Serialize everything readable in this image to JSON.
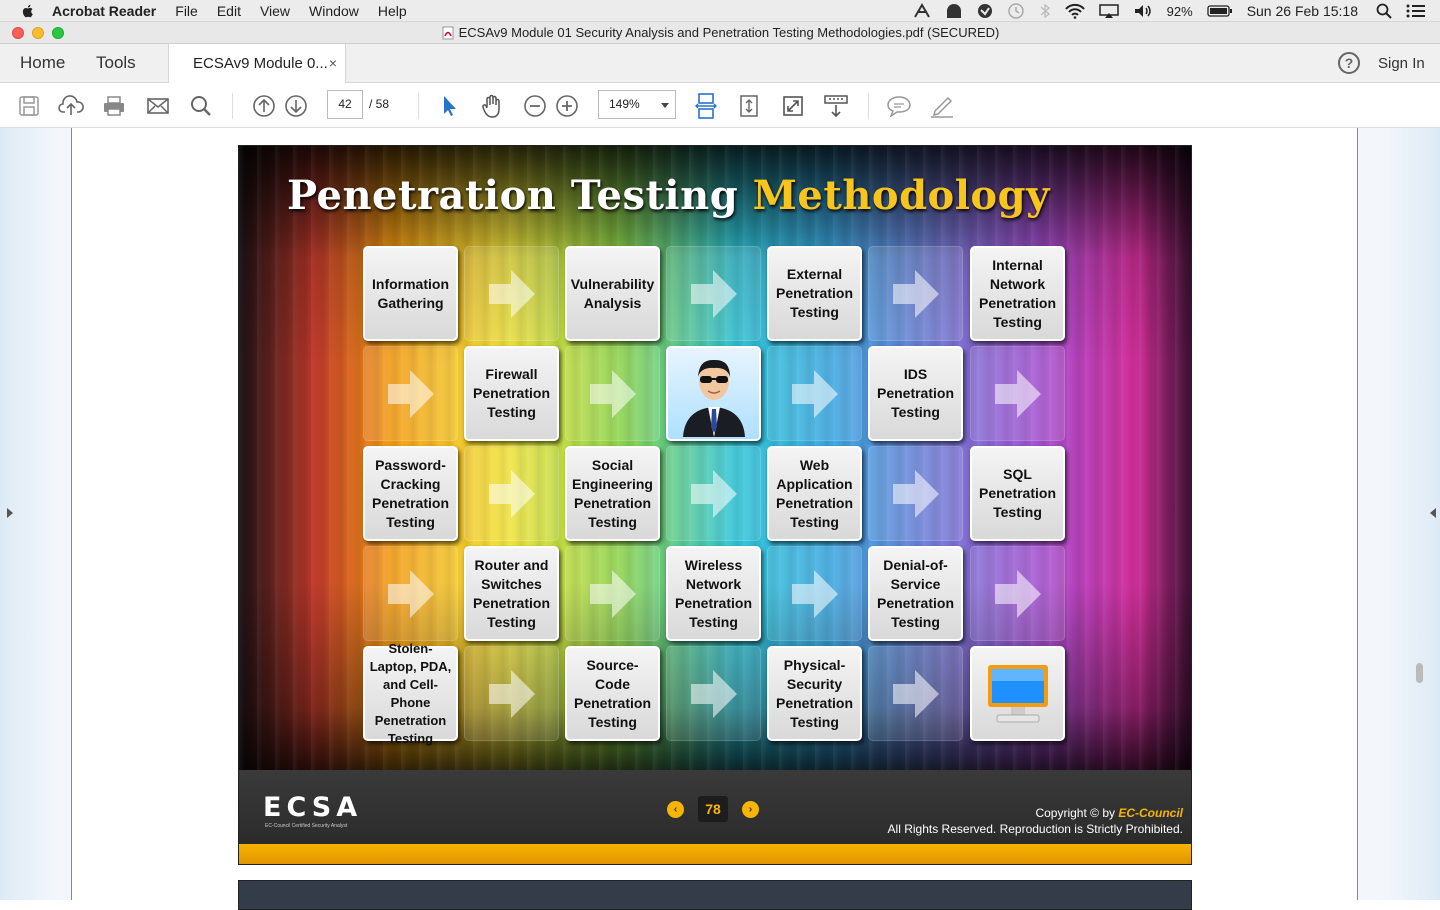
{
  "menubar": {
    "app_name": "Acrobat Reader",
    "items": [
      "File",
      "Edit",
      "View",
      "Window",
      "Help"
    ],
    "battery": "92%",
    "datetime": "Sun 26 Feb  15:18"
  },
  "window": {
    "title": "ECSAv9 Module 01 Security Analysis and Penetration Testing Methodologies.pdf (SECURED)"
  },
  "tabs": {
    "home": "Home",
    "tools": "Tools",
    "document": "ECSAv9 Module 0...",
    "close": "×",
    "help": "?",
    "sign_in": "Sign In"
  },
  "toolbar": {
    "current_page": "42",
    "page_total": "/  58",
    "zoom": "149%"
  },
  "slide": {
    "title_main": "Penetration Testing ",
    "title_highlight": "Methodology",
    "boxes": [
      "Information Gathering",
      "Vulnerability Analysis",
      "External Penetration Testing",
      "Internal Network Penetration Testing",
      "Firewall Penetration Testing",
      "IDS Penetration Testing",
      "Password-Cracking Penetration Testing",
      "Social Engineering Penetration Testing",
      "Web Application Penetration Testing",
      "SQL Penetration Testing",
      "Router and Switches Penetration Testing",
      "Wireless Network Penetration Testing",
      "Denial-of-Service Penetration Testing",
      "Stolen-Laptop, PDA, and Cell-Phone Penetration Testing",
      "Source-Code Penetration Testing",
      "Physical-Security Penetration Testing"
    ],
    "footer": {
      "logo": "ECSA",
      "logo_sub": "EC-Council Certified Security Analyst",
      "page": "78",
      "copyright": "Copyright © by ",
      "brand": "EC-Council",
      "rights": "All Rights Reserved. Reproduction is Strictly Prohibited."
    }
  },
  "icons": [
    "apple-icon",
    "save-icon",
    "upload-icon",
    "print-icon",
    "email-icon",
    "search-icon",
    "prev-page-icon",
    "next-page-icon",
    "select-cursor-icon",
    "hand-icon",
    "zoom-out-icon",
    "zoom-in-icon",
    "scroll-mode-icon",
    "fit-page-icon",
    "full-screen-icon",
    "read-mode-icon",
    "comment-icon",
    "sign-icon",
    "businessman-icon",
    "computer-monitor-icon"
  ],
  "colors": {
    "accent_yellow": "#f8c51c",
    "toolbar_blue": "#2a73c9"
  }
}
